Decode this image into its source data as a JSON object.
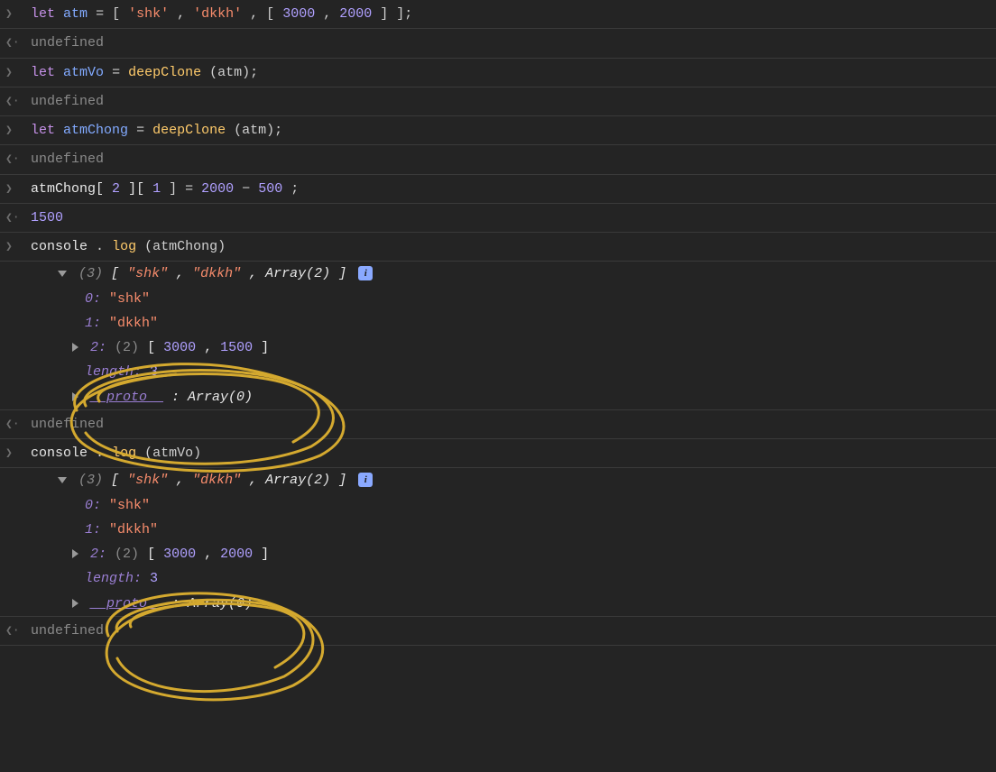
{
  "lines": {
    "l1": {
      "let": "let",
      "var": "atm",
      "eq": " = [",
      "s1": "'shk'",
      "c1": ", ",
      "s2": "'dkkh'",
      "c2": ", [",
      "n1": "3000",
      "c3": ", ",
      "n2": "2000",
      "end": "] ];"
    },
    "r1": "undefined",
    "l2": {
      "let": "let",
      "var": "atmVo",
      "eq": " = ",
      "fn": "deepClone",
      "args": "(atm);"
    },
    "r2": "undefined",
    "l3": {
      "let": "let",
      "var": "atmChong",
      "eq": " = ",
      "fn": "deepClone",
      "args": "(atm);"
    },
    "r3": "undefined",
    "l4": {
      "obj": "atmChong[",
      "i1": "2",
      "mid": "][",
      "i2": "1",
      "rest": "] = ",
      "n1": "2000",
      "op": " − ",
      "n2": "500",
      "semi": ";"
    },
    "r4": "1500",
    "l5": {
      "console": "console",
      "dot": ".",
      "log": "log",
      "args": "(atmChong)"
    },
    "exp1": {
      "summary_count": "(3)",
      "summary_open": " [",
      "s1": "\"shk\"",
      "c": ", ",
      "s2": "\"dkkh\"",
      "arr": "Array(2)",
      "close": "]",
      "k0": "0: ",
      "v0": "\"shk\"",
      "k1": "1: ",
      "v1": "\"dkkh\"",
      "k2": "2: ",
      "v2count": "(2)",
      "v2open": " [",
      "v2n1": "3000",
      "v2c": ", ",
      "v2n2": "1500",
      "v2close": "]",
      "len_k": "length: ",
      "len_v": "3",
      "proto_k": "__proto__",
      "proto_v": ": Array(0)"
    },
    "r5": "undefined",
    "l6": {
      "console": "console",
      "dot": ".",
      "log": "log",
      "args": "(atmVo)"
    },
    "exp2": {
      "summary_count": "(3)",
      "summary_open": " [",
      "s1": "\"shk\"",
      "c": ", ",
      "s2": "\"dkkh\"",
      "arr": "Array(2)",
      "close": "]",
      "k0": "0: ",
      "v0": "\"shk\"",
      "k1": "1: ",
      "v1": "\"dkkh\"",
      "k2": "2: ",
      "v2count": "(2)",
      "v2open": " [",
      "v2n1": "3000",
      "v2c": ", ",
      "v2n2": "2000",
      "v2close": "]",
      "len_k": "length: ",
      "len_v": "3",
      "proto_k": "__proto__",
      "proto_v": ": Array(0)"
    },
    "r6": "undefined"
  },
  "icons": {
    "input": "❯",
    "output": "❮⋅",
    "info": "i"
  }
}
